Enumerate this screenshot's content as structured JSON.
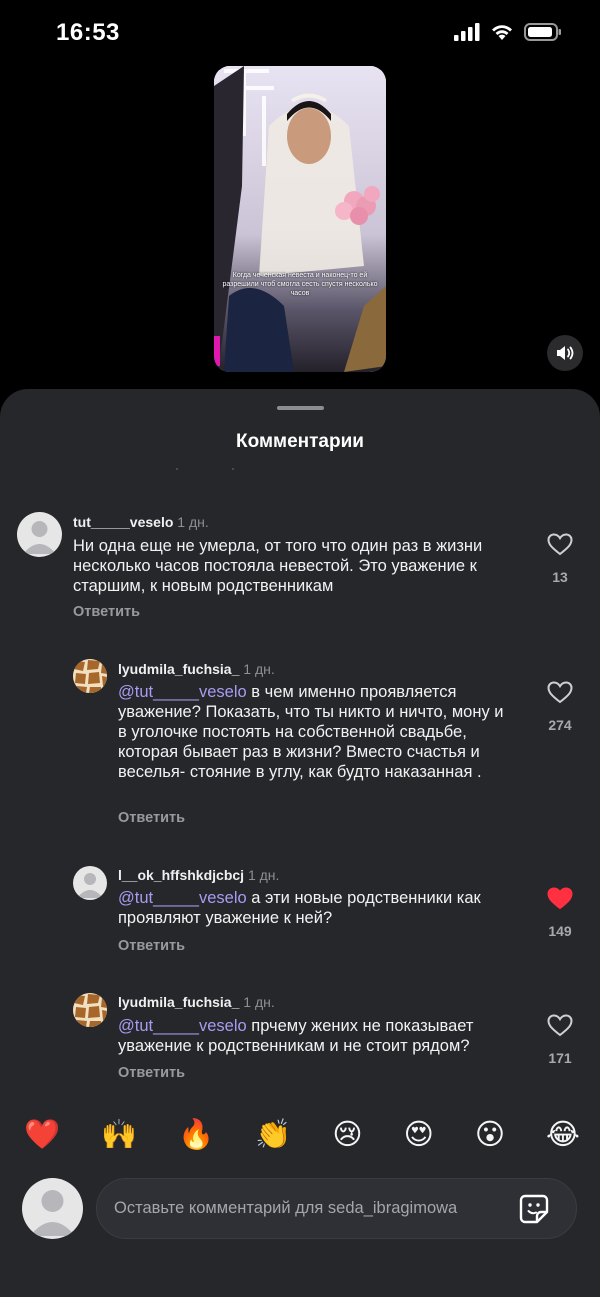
{
  "status_bar": {
    "time": "16:53",
    "icons": [
      "signal-icon",
      "wifi-icon",
      "battery-icon"
    ]
  },
  "video": {
    "caption": "Когда чеченская невеста и наконец-то ей разрешили чтоб смогла сесть спустя несколько часов"
  },
  "sheet": {
    "title": "Комментарии"
  },
  "comments": [
    {
      "username": "tut_____veselo",
      "time": "1 дн.",
      "mention": "",
      "text": "Ни одна  еще не умерла, от того что один раз в жизни несколько часов постояла невестой. Это уважение к старшим, к новым родственникам",
      "reply_label": "Ответить",
      "likes": "13",
      "liked": false
    },
    {
      "username": "lyudmila_fuchsia_",
      "time": "1 дн.",
      "mention": "@tut_____veselo",
      "text": " в чем именно проявляется уважение? Показать, что ты никто и ничто, мону и в уголочке постоять  на собственной свадьбе,  которая бывает раз в жизни? Вместо счастья и веселья- стояние в углу, как будто наказанная .",
      "reply_label": "Ответить",
      "likes": "274",
      "liked": false
    },
    {
      "username": "l__ok_hffshkdjcbcj",
      "time": "1 дн.",
      "mention": "@tut_____veselo",
      "text": " а эти новые родственники как проявляют уважение к ней?",
      "reply_label": "Ответить",
      "likes": "149",
      "liked": true
    },
    {
      "username": "lyudmila_fuchsia_",
      "time": "1 дн.",
      "mention": "@tut_____veselo",
      "text": " прчему жених не показывает уважение к родственникам и не стоит рядом?",
      "reply_label": "Ответить",
      "likes": "171",
      "liked": false
    }
  ],
  "emoji_reactions": [
    "❤️",
    "🙌",
    "🔥",
    "👏",
    "😢",
    "😍",
    "😮",
    "😂"
  ],
  "composer": {
    "placeholder": "Оставьте комментарий для seda_ibragimowa"
  },
  "colors": {
    "sheet_background": "#25272b",
    "mention": "#a79cf0",
    "liked_heart": "#ff3040"
  }
}
